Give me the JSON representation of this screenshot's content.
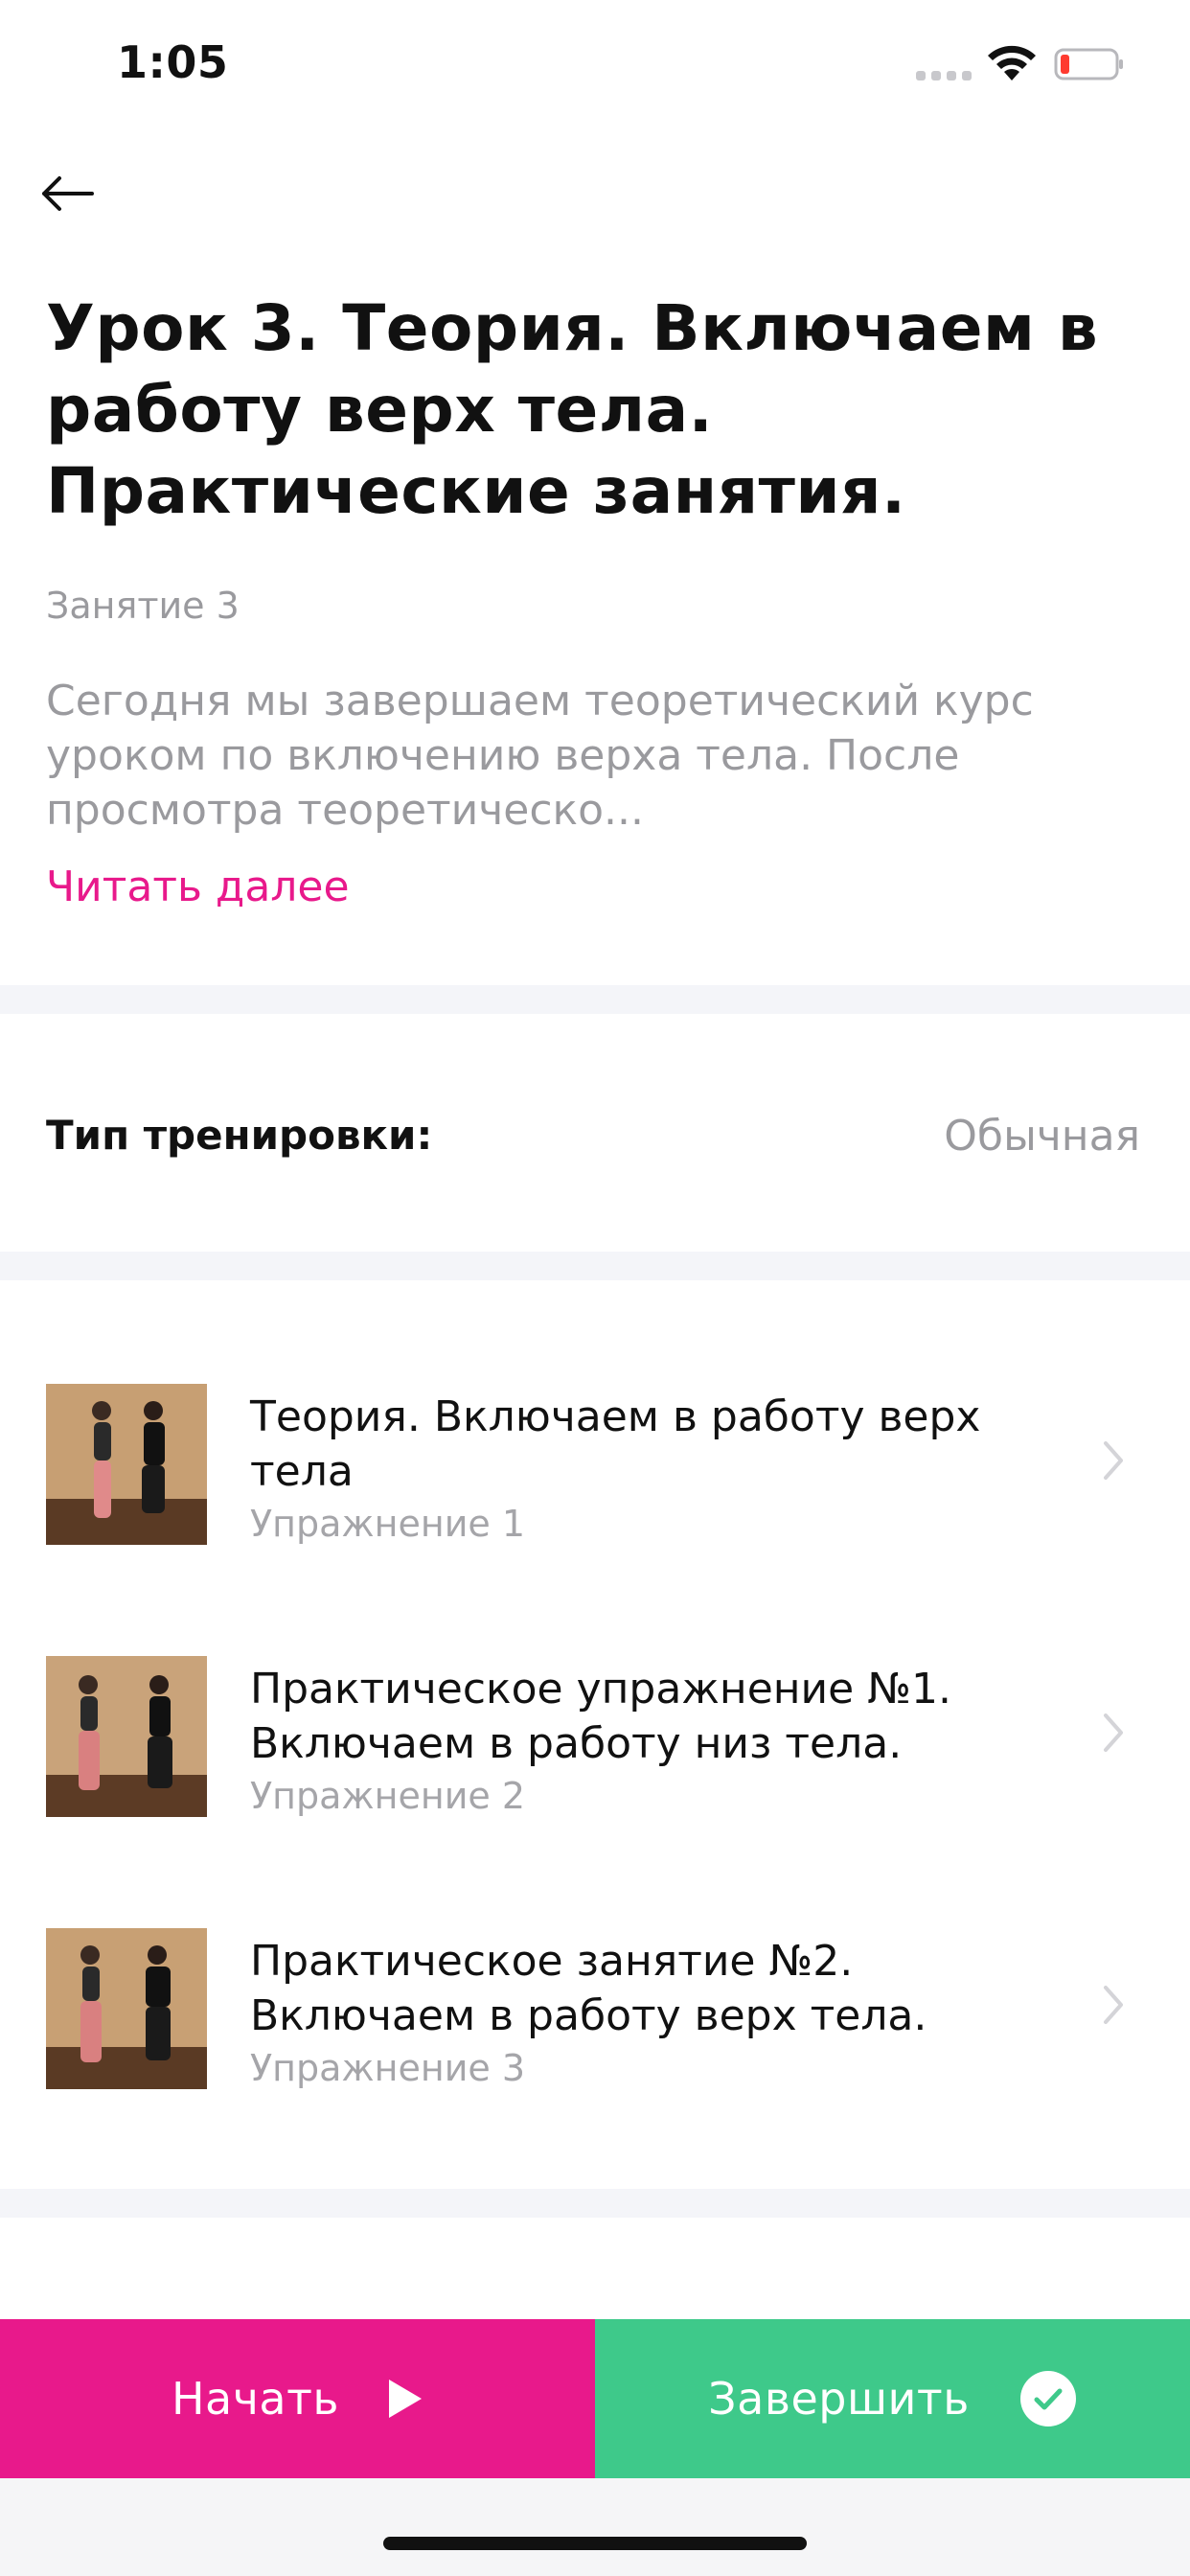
{
  "status_bar": {
    "time": "1:05"
  },
  "header": {
    "back_icon": "arrow-left-icon",
    "title": "Урок 3. Теория. Включаем в работу верх тела. Практические занятия.",
    "lesson_number": "Занятие 3",
    "description": "Сегодня мы завершаем теоретический курс уроком по включению верха тела. После просмотра теоретическо...",
    "read_more": "Читать далее"
  },
  "workout_type": {
    "label": "Тип тренировки:",
    "value": "Обычная"
  },
  "exercises": [
    {
      "title": "Теория. Включаем в работу верх тела",
      "subtitle": "Упражнение 1"
    },
    {
      "title": "Практическое упражнение №1. Включаем в работу низ тела.",
      "subtitle": "Упражнение 2"
    },
    {
      "title": "Практическое занятие №2. Включаем в работу верх тела.",
      "subtitle": "Упражнение 3"
    }
  ],
  "actions": {
    "start_label": "Начать",
    "finish_label": "Завершить"
  },
  "colors": {
    "accent_pink": "#e8198b",
    "accent_green": "#3ec98a",
    "muted_text": "#9a9a9e",
    "section_divider": "#f4f5f9"
  }
}
